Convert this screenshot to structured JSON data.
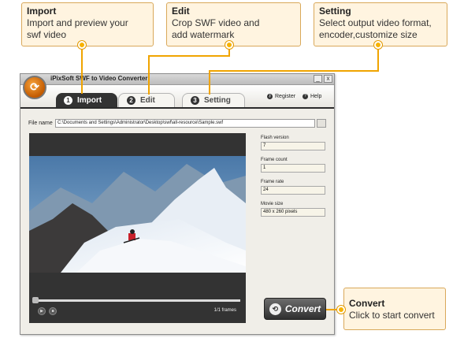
{
  "callouts": {
    "import": {
      "title": "Import",
      "desc_line1": "Import and preview your",
      "desc_line2": "swf video"
    },
    "edit": {
      "title": "Edit",
      "desc_line1": "Crop SWF video and",
      "desc_line2": "add watermark"
    },
    "setting": {
      "title": "Setting",
      "desc_line1": "Select output video format,",
      "desc_line2": "encoder,customize size"
    },
    "convert": {
      "title": "Convert",
      "desc_line1": "Click to start convert"
    }
  },
  "window": {
    "title": "iPixSoft SWF to Video Converter",
    "minimize": "_",
    "close": "x"
  },
  "tabs": [
    {
      "number": "1",
      "label": "Import",
      "active": true
    },
    {
      "number": "2",
      "label": "Edit",
      "active": false
    },
    {
      "number": "3",
      "label": "Setting",
      "active": false
    }
  ],
  "toplinks": {
    "register": "Register",
    "help": "Help"
  },
  "file": {
    "label": "File name",
    "path": "C:\\Documents and Settings\\Administrator\\Desktop\\swf\\all-resource\\Sample.swf"
  },
  "info": {
    "flash_version_label": "Flash version",
    "flash_version_value": "7",
    "frame_count_label": "Frame count",
    "frame_count_value": "1",
    "frame_rate_label": "Frame rate",
    "frame_rate_value": "24",
    "movie_size_label": "Movie size",
    "movie_size_value": "480 x 260 pixels"
  },
  "player": {
    "frames": "1/1 frames",
    "progress": 0
  },
  "convert_button": {
    "label": "Convert"
  },
  "colors": {
    "accent": "#f0a400",
    "callout_bg": "#fff4e0",
    "tab_active": "#333333"
  }
}
